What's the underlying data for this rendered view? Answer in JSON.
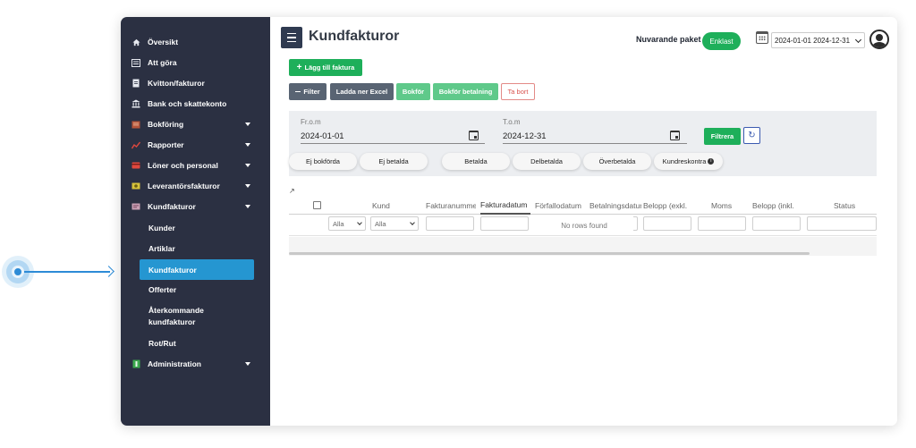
{
  "sidebar": {
    "items": [
      {
        "label": "Översikt",
        "icon": "home-icon"
      },
      {
        "label": "Att göra",
        "icon": "list-icon"
      },
      {
        "label": "Kvitton/fakturor",
        "icon": "receipt-icon"
      },
      {
        "label": "Bank och skattekonto",
        "icon": "bank-icon"
      },
      {
        "label": "Bokföring",
        "icon": "book-icon"
      },
      {
        "label": "Rapporter",
        "icon": "chart-icon"
      },
      {
        "label": "Löner och personal",
        "icon": "card-icon"
      },
      {
        "label": "Leverantörsfakturor",
        "icon": "money-icon"
      },
      {
        "label": "Kundfakturor",
        "icon": "invoice-icon"
      },
      {
        "label": "Administration",
        "icon": "admin-icon"
      }
    ],
    "sub_items": [
      {
        "label": "Kunder"
      },
      {
        "label": "Artiklar"
      },
      {
        "label": "Kundfakturor"
      },
      {
        "label": "Offerter"
      },
      {
        "label": "Återkommande kundfakturor"
      },
      {
        "label": "Rot/Rut"
      }
    ]
  },
  "header": {
    "title": "Kundfakturor",
    "plan_label": "Nuvarande paket",
    "plan_badge": "Enklast",
    "date_range": "2024-01-01 2024-12-31"
  },
  "toolbar": {
    "add_label": "Lägg till faktura",
    "filter_label": "Filter",
    "excel_label": "Ladda ner Excel",
    "bokfor_label": "Bokför",
    "bokfor_betalning_label": "Bokför betalning",
    "tabort_label": "Ta bort"
  },
  "filter": {
    "from_label": "Fr.o.m",
    "from_value": "2024-01-01",
    "to_label": "T.o.m",
    "to_value": "2024-12-31",
    "filtrera_label": "Filtrera",
    "pills": [
      "Ej bokförda",
      "Ej betalda",
      "Betalda",
      "Delbetalda",
      "Överbetalda",
      "Kundreskontra"
    ]
  },
  "grid": {
    "columns": [
      "Kund",
      "Fakturanummer",
      "Fakturadatum",
      "Förfallodatum",
      "Betalningsdatum",
      "Belopp (exkl.",
      "Moms",
      "Belopp (inkl.",
      "Status"
    ],
    "filter_select_1": "Alla",
    "filter_select_2": "Alla",
    "empty_text": "No rows found"
  },
  "colors": {
    "sidebar_bg": "#2b3042",
    "active_item": "#2596d1",
    "green": "#1eaf5a",
    "grey_button": "#596473"
  }
}
